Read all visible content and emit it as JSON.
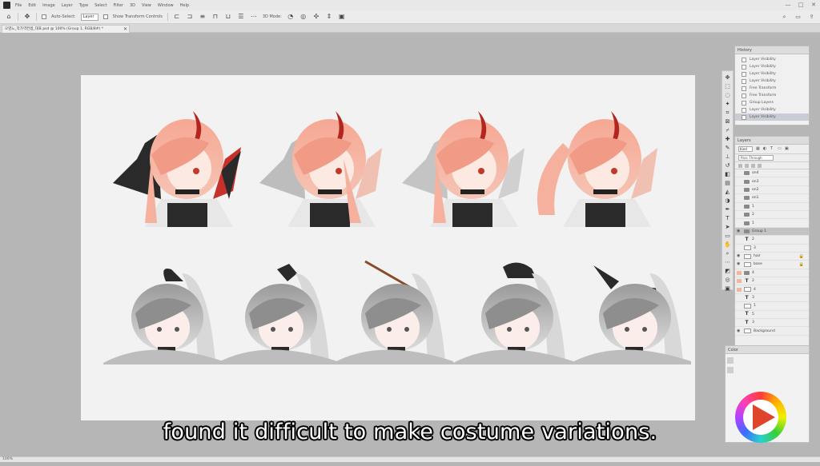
{
  "menubar": {
    "items": [
      "File",
      "Edit",
      "Image",
      "Layer",
      "Type",
      "Select",
      "Filter",
      "3D",
      "View",
      "Window",
      "Help"
    ],
    "window_controls": [
      "—",
      "□",
      "✕"
    ]
  },
  "options_bar": {
    "auto_select_label": "Auto-Select:",
    "layer_select_value": "Layer",
    "show_transform_label": "Show Transform Controls",
    "mode_label": "3D Mode:"
  },
  "document_tab": {
    "title": "오영느_작가역컨셉_대표.psd @ 100% (Group 1, RGB/8#) *",
    "close": "✕"
  },
  "history_panel": {
    "title": "History",
    "items": [
      "Layer Visibility",
      "Layer Visibility",
      "Layer Visibility",
      "Layer Visibility",
      "Free Transform",
      "Free Transform",
      "Group Layers",
      "Layer Visibility",
      "Layer Visibility"
    ]
  },
  "layers_panel": {
    "title": "Layers",
    "kind_label": "Kind",
    "blend_mode": "Pass Through",
    "layers": [
      {
        "type": "folder",
        "name": "on4"
      },
      {
        "type": "folder",
        "name": "on3"
      },
      {
        "type": "folder",
        "name": "on2"
      },
      {
        "type": "folder",
        "name": "on1"
      },
      {
        "type": "folder",
        "name": "1"
      },
      {
        "type": "folder",
        "name": "2"
      },
      {
        "type": "folder",
        "name": "1"
      },
      {
        "type": "folder",
        "name": "Group 1"
      },
      {
        "type": "text",
        "name": "2"
      },
      {
        "type": "thumb",
        "name": "3"
      },
      {
        "type": "thumb",
        "name": "hair"
      },
      {
        "type": "thumb",
        "name": "base"
      },
      {
        "type": "folder",
        "name": "4"
      },
      {
        "type": "text",
        "name": "2"
      },
      {
        "type": "thumb",
        "name": "4"
      },
      {
        "type": "text",
        "name": "3"
      },
      {
        "type": "thumb",
        "name": "1"
      },
      {
        "type": "text",
        "name": "5"
      },
      {
        "type": "text",
        "name": "3"
      },
      {
        "type": "thumb",
        "name": "Background"
      }
    ]
  },
  "color_panel": {
    "title": "Color"
  },
  "status_bar": {
    "zoom": "100%"
  },
  "subtitle": {
    "text": "found it difficult to make costume variations."
  }
}
